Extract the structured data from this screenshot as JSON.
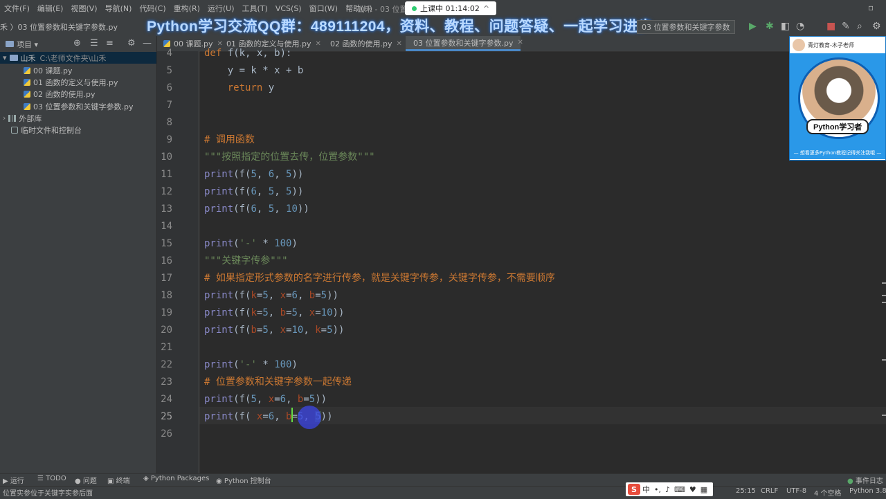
{
  "menu": {
    "items": [
      "文件(F)",
      "编辑(E)",
      "视图(V)",
      "导航(N)",
      "代码(C)",
      "重构(R)",
      "运行(U)",
      "工具(T)",
      "VCS(S)",
      "窗口(W)",
      "帮助(H)"
    ],
    "window_title": "山禾 - 03 位置参",
    "live_badge": "上课中 01:14:02",
    "live_chevron": "^"
  },
  "toolbar": {
    "breadcrumb": "禾 〉03 位置参数和关键字参数.py",
    "banner": "Python学习交流QQ群：489111204，资料、教程、问题答疑、一起学习进步",
    "run_config": "03 位置参数和关键字参数"
  },
  "project": {
    "panel_title": "项目",
    "root": {
      "name": "山禾",
      "path": "C:\\老师文件夹\\山禾"
    },
    "files": [
      "00 课题.py",
      "01 函数的定义与使用.py",
      "02 函数的使用.py",
      "03 位置参数和关键字参数.py"
    ],
    "external_libs": "外部库",
    "scratches": "临时文件和控制台"
  },
  "tabs": [
    "00 课题.py",
    "01 函数的定义与使用.py",
    "02 函数的使用.py",
    "03 位置参数和关键字参数.py"
  ],
  "editor": {
    "line_numbers": [
      "4",
      "5",
      "6",
      "7",
      "8",
      "9",
      "10",
      "11",
      "12",
      "13",
      "14",
      "15",
      "16",
      "17",
      "18",
      "19",
      "20",
      "21",
      "22",
      "23",
      "24",
      "25",
      "26"
    ],
    "current_line": "25",
    "lines": {
      "l4": {
        "def": "def",
        "rest": " f(k, x, b):"
      },
      "l5": {
        "a": "    y = k * x + b"
      },
      "l6": {
        "kw": "return",
        "rest": " y"
      },
      "l9": "# 调用函数",
      "l10": "\"\"\"按照指定的位置去传，位置参数\"\"\"",
      "l11": {
        "fn": "print",
        "a": "(f(",
        "n1": "5",
        "c1": ", ",
        "n2": "6",
        "c2": ", ",
        "n3": "5",
        "end": "))"
      },
      "l12": {
        "fn": "print",
        "a": "(f(",
        "n1": "6",
        "c1": ", ",
        "n2": "5",
        "c2": ", ",
        "n3": "5",
        "end": "))"
      },
      "l13": {
        "fn": "print",
        "a": "(f(",
        "n1": "6",
        "c1": ", ",
        "n2": "5",
        "c2": ", ",
        "n3": "10",
        "end": "))"
      },
      "l15": {
        "fn": "print",
        "a": "(",
        "s": "'-'",
        "op": " * ",
        "n": "100",
        "end": ")"
      },
      "l16": "\"\"\"关键字传参\"\"\"",
      "l17": "# 如果指定形式参数的名字进行传参，就是关键字传参，关键字传参，不需要顺序",
      "l18": {
        "fn": "print",
        "a": "(f(",
        "p1": "k",
        "v1": "=",
        "n1": "5",
        "c1": ", ",
        "p2": "x",
        "v2": "=",
        "n2": "6",
        "c2": ", ",
        "p3": "b",
        "v3": "=",
        "n3": "5",
        "end": "))"
      },
      "l19": {
        "fn": "print",
        "a": "(f(",
        "p1": "k",
        "v1": "=",
        "n1": "5",
        "c1": ", ",
        "p2": "b",
        "v2": "=",
        "n2": "5",
        "c2": ", ",
        "p3": "x",
        "v3": "=",
        "n3": "10",
        "end": "))"
      },
      "l20": {
        "fn": "print",
        "a": "(f(",
        "p1": "b",
        "v1": "=",
        "n1": "5",
        "c1": ", ",
        "p2": "x",
        "v2": "=",
        "n2": "10",
        "c2": ", ",
        "p3": "k",
        "v3": "=",
        "n3": "5",
        "end": "))"
      },
      "l22": {
        "fn": "print",
        "a": "(",
        "s": "'-'",
        "op": " * ",
        "n": "100",
        "end": ")"
      },
      "l23": "# 位置参数和关键字参数一起传递",
      "l24": {
        "fn": "print",
        "a": "(f(",
        "n1": "5",
        "c1": ", ",
        "p2": "x",
        "v2": "=",
        "n2": "6",
        "c2": ", ",
        "p3": "b",
        "v3": "=",
        "n3": "5",
        "end": "))"
      },
      "l25": {
        "fn": "print",
        "a": "(f( ",
        "p1": "x",
        "v1": "=",
        "n1": "6",
        "c1": ", ",
        "p2": "b",
        "v2": "=",
        "n2": "5",
        "c2": ", ",
        "n3": "5",
        "end": "))"
      }
    }
  },
  "cam": {
    "teacher": "青灯教育-木子老师",
    "badge": "Python学习者",
    "footer": "— 想看更多Python教程记得关注我哦 —"
  },
  "bottom_tools": [
    "运行",
    "TODO",
    "问题",
    "终端",
    "Python Packages",
    "Python 控制台",
    "事件日志"
  ],
  "status": {
    "message": "位置实参位于关键字实参后面",
    "position": "25:15",
    "line_sep": "CRLF",
    "encoding": "UTF-8",
    "indent": "4 个空格",
    "interpreter": "Python 3.8",
    "ime": "中"
  },
  "colors": {
    "keyword": "#cc7832",
    "number": "#6897bb",
    "builtin": "#8888c6",
    "string": "#6a8759",
    "param": "#aa4926",
    "caret": "#66dd44"
  }
}
